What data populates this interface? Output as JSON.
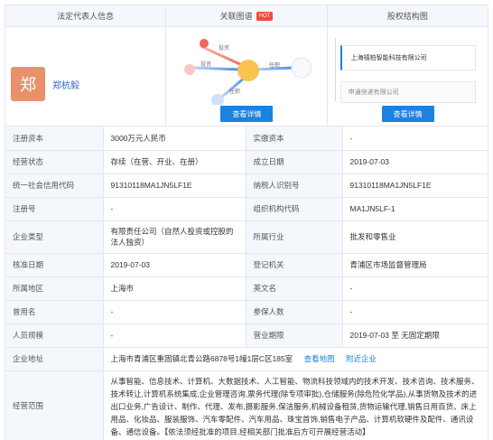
{
  "panels": {
    "legal_rep": {
      "header": "法定代表人信息",
      "avatar_char": "郑",
      "name": "郑杭毅"
    },
    "relation": {
      "header": "关联图谱",
      "badge": "HOT",
      "button": "查看详情",
      "edge_labels": [
        "投资",
        "任职",
        "任职",
        "投资"
      ]
    },
    "equity": {
      "header": "股权结构图",
      "company": "上海禧柏智能科技有限公司",
      "shareholder": "申通快递有限公司",
      "button": "查看详情"
    }
  },
  "table": {
    "rows": [
      {
        "l1": "注册资本",
        "v1": "3000万元人民币",
        "l2": "实缴资本",
        "v2": "-"
      },
      {
        "l1": "经营状态",
        "v1": "存续（在营、开业、在册）",
        "l2": "成立日期",
        "v2": "2019-07-03"
      },
      {
        "l1": "统一社会信用代码",
        "v1": "91310118MA1JN5LF1E",
        "l2": "纳税人识别号",
        "v2": "91310118MA1JN5LF1E"
      },
      {
        "l1": "注册号",
        "v1": "-",
        "l2": "组织机构代码",
        "v2": "MA1JN5LF-1"
      },
      {
        "l1": "企业类型",
        "v1": "有限责任公司（自然人投资或控股的法人独资）",
        "l2": "所属行业",
        "v2": "批发和零售业"
      },
      {
        "l1": "核准日期",
        "v1": "2019-07-03",
        "l2": "登记机关",
        "v2": "青浦区市场监督管理局"
      },
      {
        "l1": "所属地区",
        "v1": "上海市",
        "l2": "英文名",
        "v2": "-"
      },
      {
        "l1": "曾用名",
        "v1": "-",
        "l2": "参保人数",
        "v2": "-"
      },
      {
        "l1": "人员规模",
        "v1": "-",
        "l2": "营业期限",
        "v2": "2019-07-03 至 无固定期限"
      }
    ],
    "address": {
      "label": "企业地址",
      "value": "上海市青浦区重固镇北青公路6878号1幢1层C区185室",
      "map_link": "查看地图",
      "nearby_link": "附近企业"
    },
    "scope": {
      "label": "经营范围",
      "value": "从事智能、信息技术、计算机、大数据技术、人工智能、物流科技领域内的技术开发、技术咨询、技术服务、技术转让,计算机系统集成,企业管理咨询,票务代理(除专项审批),仓储服务(除危险化学品),从事货物及技术的进出口业务,广告设计、制作、代理、发布,摄影服务,保洁服务,机械设备租赁,货物运输代理,销售日用百货、床上用品、化妆品、服装服饰、汽车零配件、汽车用品、珠宝首饰,销售电子产品、计算机软硬件及配件、通讯设备、通信设备。【依法须经批准的项目,经相关部门批准后方可开展经营活动】"
    }
  },
  "colors": {
    "accent": "#1c82e0",
    "avatar": "#e8916b",
    "label_bg": "#f4f7fb"
  }
}
